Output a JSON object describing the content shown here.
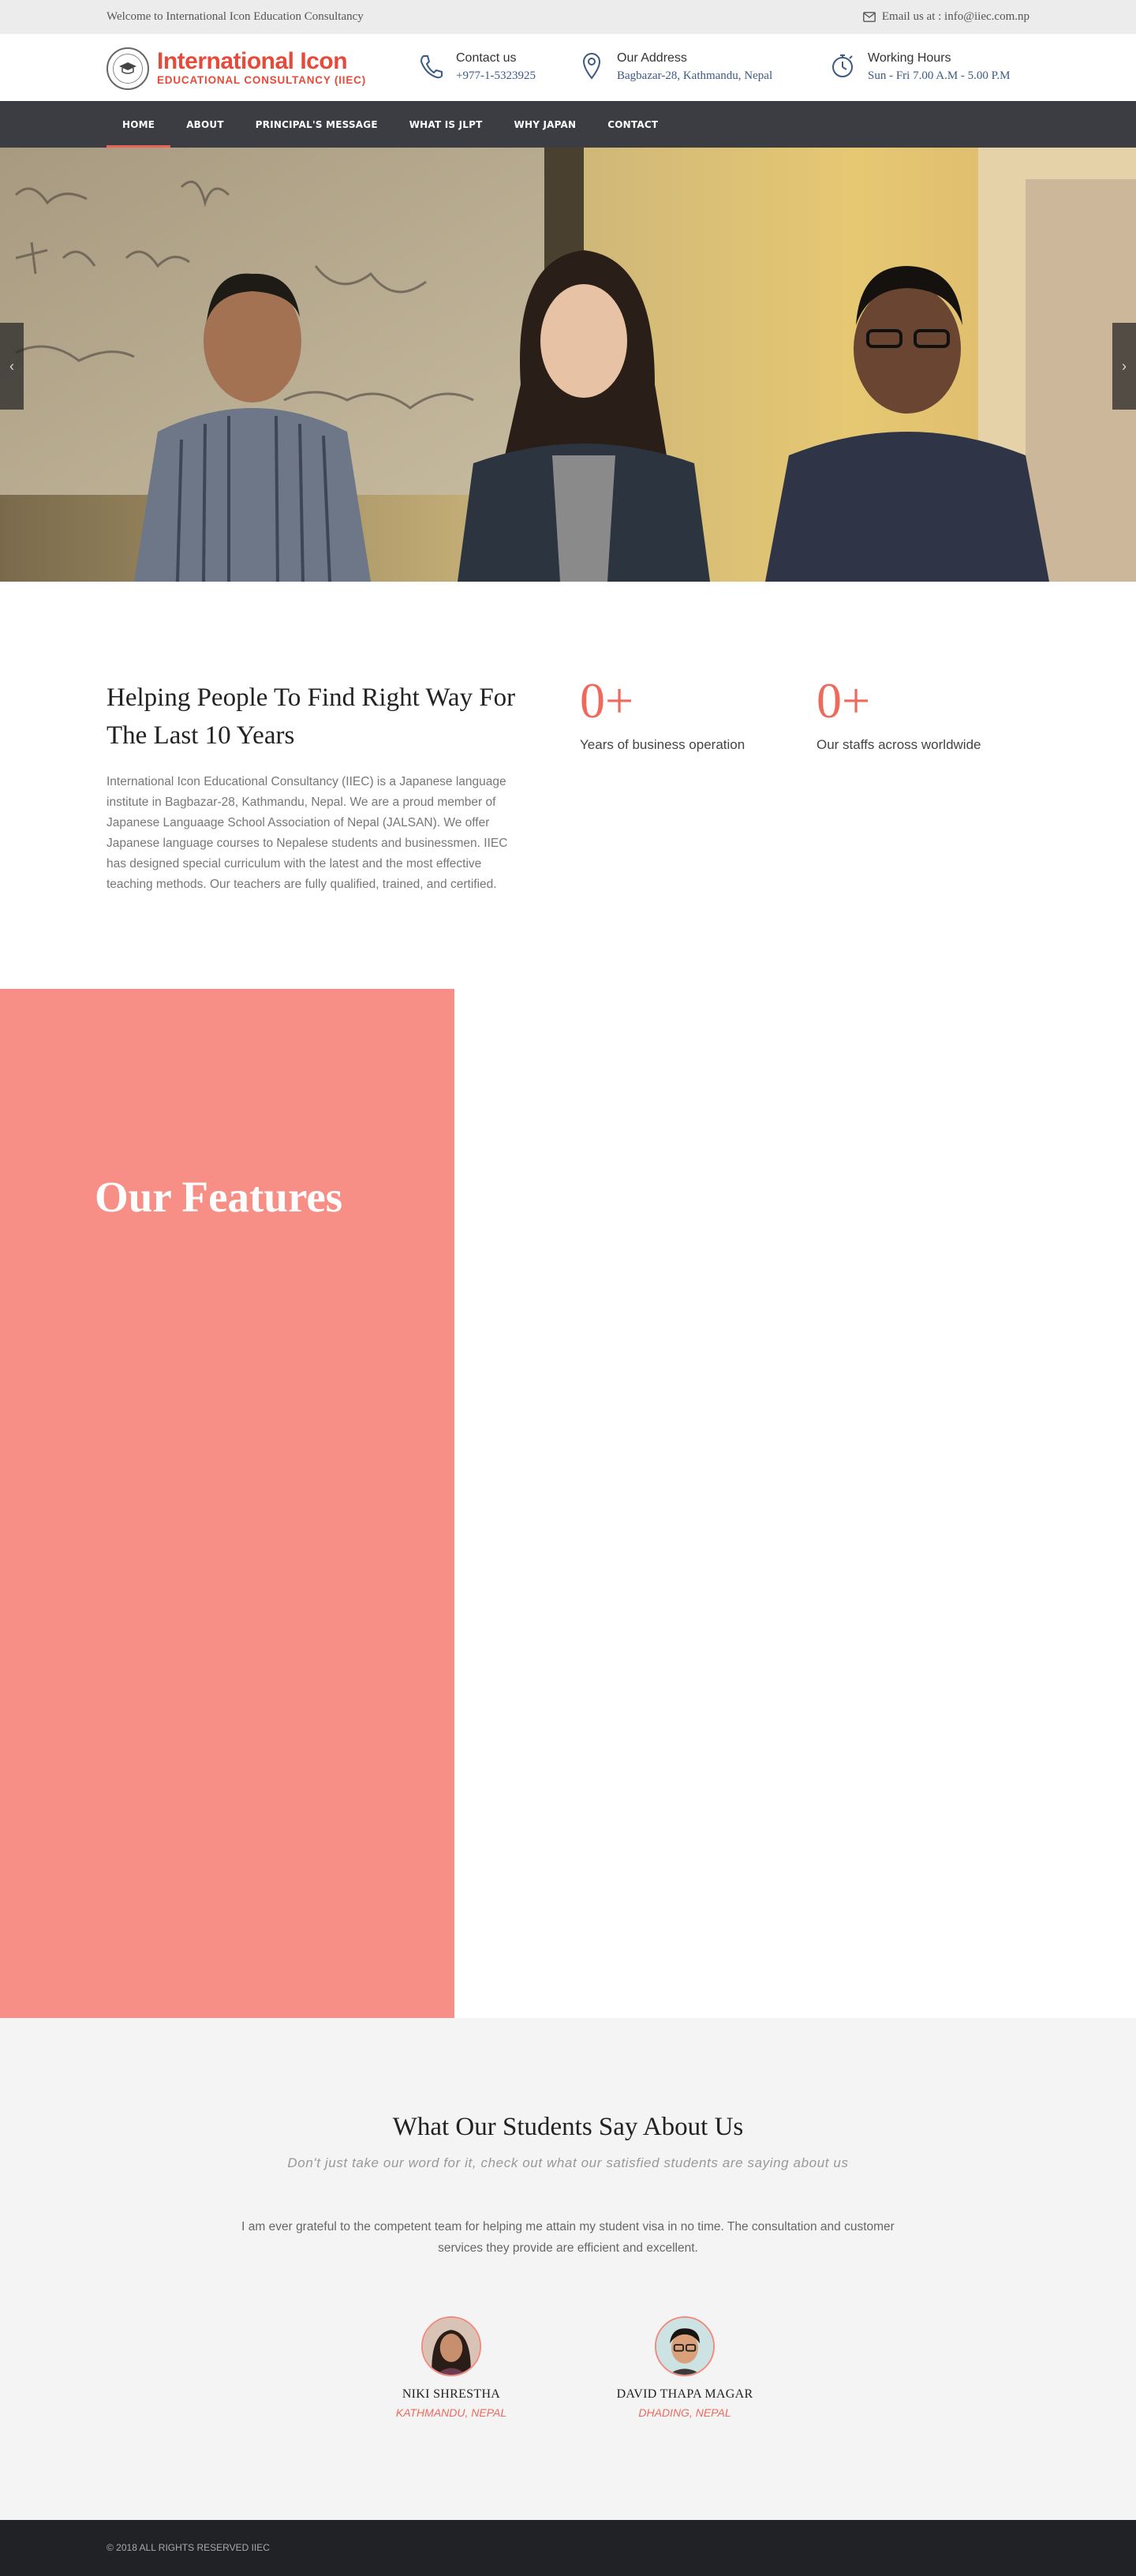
{
  "topbar": {
    "welcome": "Welcome to International Icon Education Consultancy",
    "email_icon": "envelope-icon",
    "email": "Email us at : info@iiec.com.np"
  },
  "header": {
    "logo": {
      "line1": "International Icon",
      "line2": "EDUCATIONAL CONSULTANCY (IIEC)"
    },
    "contact": {
      "icon": "phone-icon",
      "title": "Contact us",
      "value": "+977-1-5323925"
    },
    "address": {
      "icon": "map-pin-icon",
      "title": "Our Address",
      "value": "Bagbazar-28, Kathmandu, Nepal"
    },
    "hours": {
      "icon": "stopwatch-icon",
      "title": "Working Hours",
      "value": "Sun - Fri 7.00 A.M - 5.00 P.M"
    }
  },
  "nav": {
    "items": [
      "HOME",
      "ABOUT",
      "PRINCIPAL'S MESSAGE",
      "WHAT IS JLPT",
      "WHY JAPAN",
      "CONTACT"
    ],
    "active_index": 0
  },
  "hero": {
    "prev_icon": "chevron-left-icon",
    "next_icon": "chevron-right-icon"
  },
  "about": {
    "title": "Helping People To Find Right Way For The Last 10 Years",
    "text": "International Icon Educational Consultancy (IIEC) is a Japanese language institute in Bagbazar-28, Kathmandu, Nepal. We are a proud member of Japanese Languaage School Association of Nepal (JALSAN). We offer Japanese language courses to Nepalese students and businessmen. IIEC has designed special curriculum with the latest and the most effective teaching methods. Our teachers are fully qualified, trained, and certified.",
    "stats": [
      {
        "number": "0+",
        "label": "Years of business operation"
      },
      {
        "number": "0+",
        "label": "Our staffs across worldwide"
      }
    ]
  },
  "features": {
    "title": "Our Features"
  },
  "testimonials": {
    "title": "What Our Students Say About Us",
    "subtitle": "Don't just take our word for it, check out what our satisfied students are saying about us",
    "quote": "I am ever grateful to the competent team for helping me attain my student visa in no time. The consultation and customer services they provide are efficient and excellent.",
    "people": [
      {
        "name": "NIKI SHRESTHA",
        "location": "KATHMANDU, NEPAL"
      },
      {
        "name": "DAVID THAPA MAGAR",
        "location": "DHADING, NEPAL"
      }
    ]
  },
  "footer": {
    "copyright": "© 2018 ALL RIGHTS RESERVED IIEC"
  },
  "colors": {
    "accent": "#ee6a5c",
    "features_bg": "#f78f86",
    "nav_bg": "#3b3d42",
    "footer_bg": "#202226",
    "link_blue": "#3b5a86"
  }
}
